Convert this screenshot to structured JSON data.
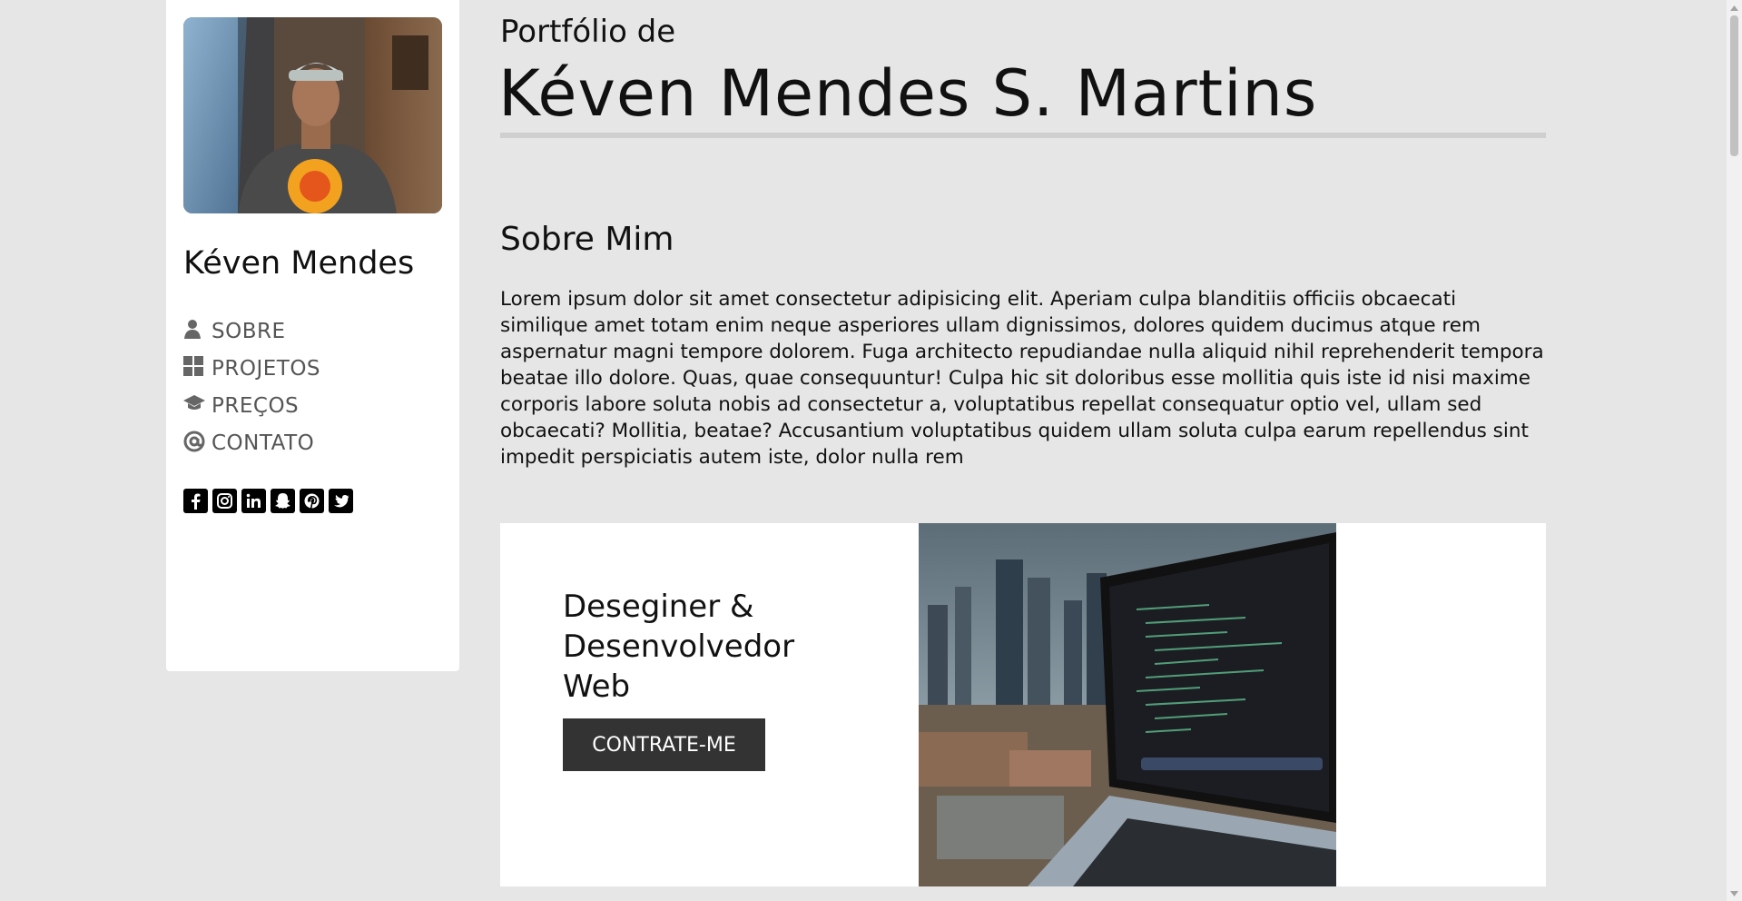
{
  "sidebar": {
    "name": "Kéven Mendes",
    "nav": [
      {
        "label": "SOBRE",
        "icon": "user-icon"
      },
      {
        "label": "PROJETOS",
        "icon": "grid-icon"
      },
      {
        "label": "PREÇOS",
        "icon": "graduation-cap-icon"
      },
      {
        "label": "CONTATO",
        "icon": "at-icon"
      }
    ],
    "social": [
      "facebook-icon",
      "instagram-icon",
      "linkedin-icon",
      "snapchat-icon",
      "pinterest-icon",
      "twitter-icon"
    ]
  },
  "header": {
    "pre_title": "Portfólio de",
    "title": "Kéven Mendes S. Martins"
  },
  "about": {
    "heading": "Sobre Mim",
    "text": "Lorem ipsum dolor sit amet consectetur adipisicing elit. Aperiam culpa blanditiis officiis obcaecati similique amet totam enim neque asperiores ullam dignissimos, dolores quidem ducimus atque rem aspernatur magni tempore dolorem. Fuga architecto repudiandae nulla aliquid nihil reprehenderit tempora beatae illo dolore. Quas, quae consequuntur! Culpa hic sit doloribus esse mollitia quis iste id nisi maxime corporis labore soluta nobis ad consectetur a, voluptatibus repellat consequatur optio vel, ullam sed obcaecati? Mollitia, beatae? Accusantium voluptatibus quidem ullam soluta culpa earum repellendus sint impedit perspiciatis autem iste, dolor nulla rem"
  },
  "hero": {
    "heading": "Deseginer & Desenvolvedor Web",
    "button": "CONTRATE-ME"
  },
  "colors": {
    "page_bg": "#e6e6e6",
    "panel_bg": "#ffffff",
    "button_bg": "#333333",
    "nav_text": "#555555"
  }
}
